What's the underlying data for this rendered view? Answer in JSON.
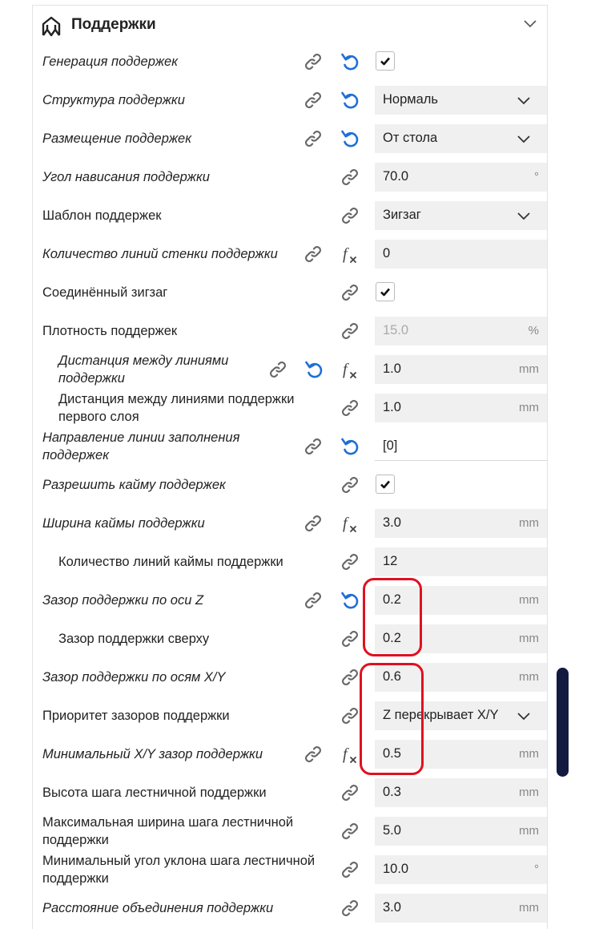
{
  "section": {
    "title": "Поддержки",
    "icon": "support-section-icon",
    "collapse_icon": "chevron-down-icon"
  },
  "accent_color": "#1f6fd6",
  "highlight_color": "#e01020",
  "rows": [
    {
      "label": "Генерация поддержек",
      "italic": true,
      "indent": false,
      "link": true,
      "reset": true,
      "fx": false,
      "control": "checkbox",
      "checked": true
    },
    {
      "label": "Структура поддержки",
      "italic": true,
      "indent": false,
      "link": true,
      "reset": true,
      "fx": false,
      "control": "select",
      "value": "Нормаль"
    },
    {
      "label": "Размещение поддержек",
      "italic": true,
      "indent": false,
      "link": true,
      "reset": true,
      "fx": false,
      "control": "select",
      "value": "От стола"
    },
    {
      "label": "Угол нависания поддержки",
      "italic": true,
      "indent": false,
      "link": true,
      "reset": false,
      "fx": false,
      "control": "number",
      "value": "70.0",
      "unit": "°"
    },
    {
      "label": "Шаблон поддержек",
      "italic": false,
      "indent": false,
      "link": true,
      "reset": false,
      "fx": false,
      "control": "select",
      "value": "Зигзаг"
    },
    {
      "label": "Количество линий стенки поддержки",
      "italic": true,
      "indent": false,
      "link": true,
      "reset": false,
      "fx": true,
      "control": "number",
      "value": "0",
      "unit": ""
    },
    {
      "label": "Соединённый зигзаг",
      "italic": false,
      "indent": false,
      "link": true,
      "reset": false,
      "fx": false,
      "control": "checkbox",
      "checked": true
    },
    {
      "label": "Плотность поддержек",
      "italic": false,
      "indent": false,
      "link": true,
      "reset": false,
      "fx": false,
      "control": "number",
      "value": "15.0",
      "unit": "%",
      "disabled": true
    },
    {
      "label": "Дистанция между линиями\nподдержки",
      "italic": true,
      "indent": true,
      "link": true,
      "reset": true,
      "fx": true,
      "control": "number",
      "value": "1.0",
      "unit": "mm"
    },
    {
      "label": "Дистанция между линиями поддержки\nпервого слоя",
      "italic": false,
      "indent": true,
      "link": true,
      "reset": false,
      "fx": false,
      "control": "number",
      "value": "1.0",
      "unit": "mm"
    },
    {
      "label": "Направление линии заполнения\nподдержек",
      "italic": true,
      "indent": false,
      "link": true,
      "reset": true,
      "fx": false,
      "control": "text",
      "value": "[0]"
    },
    {
      "label": "Разрешить кайму поддержек",
      "italic": true,
      "indent": false,
      "link": true,
      "reset": false,
      "fx": false,
      "control": "checkbox",
      "checked": true
    },
    {
      "label": "Ширина каймы поддержки",
      "italic": true,
      "indent": false,
      "link": true,
      "reset": false,
      "fx": true,
      "control": "number",
      "value": "3.0",
      "unit": "mm"
    },
    {
      "label": "Количество линий каймы поддержки",
      "italic": false,
      "indent": true,
      "link": true,
      "reset": false,
      "fx": false,
      "control": "number",
      "value": "12",
      "unit": ""
    },
    {
      "label": "Зазор поддержки по оси Z",
      "italic": true,
      "indent": false,
      "link": true,
      "reset": true,
      "fx": false,
      "control": "number",
      "value": "0.2",
      "unit": "mm"
    },
    {
      "label": "Зазор поддержки сверху",
      "italic": false,
      "indent": true,
      "link": true,
      "reset": false,
      "fx": false,
      "control": "number",
      "value": "0.2",
      "unit": "mm"
    },
    {
      "label": "Зазор поддержки по осям X/Y",
      "italic": true,
      "indent": false,
      "link": true,
      "reset": false,
      "fx": false,
      "control": "number",
      "value": "0.6",
      "unit": "mm"
    },
    {
      "label": "Приоритет зазоров поддержки",
      "italic": false,
      "indent": false,
      "link": true,
      "reset": false,
      "fx": false,
      "control": "select",
      "value": "Z перекрывает X/Y"
    },
    {
      "label": "Минимальный X/Y зазор поддержки",
      "italic": true,
      "indent": false,
      "link": true,
      "reset": false,
      "fx": true,
      "control": "number",
      "value": "0.5",
      "unit": "mm"
    },
    {
      "label": "Высота шага лестничной поддержки",
      "italic": false,
      "indent": false,
      "link": true,
      "reset": false,
      "fx": false,
      "control": "number",
      "value": "0.3",
      "unit": "mm"
    },
    {
      "label": "Максимальная ширина шага лестничной\nподдержки",
      "italic": false,
      "indent": false,
      "link": true,
      "reset": false,
      "fx": false,
      "control": "number",
      "value": "5.0",
      "unit": "mm"
    },
    {
      "label": "Минимальный угол уклона шага лестничной\nподдержки",
      "italic": false,
      "indent": false,
      "link": true,
      "reset": false,
      "fx": false,
      "control": "number",
      "value": "10.0",
      "unit": "°"
    },
    {
      "label": "Расстояние объединения поддержки",
      "italic": true,
      "indent": false,
      "link": true,
      "reset": false,
      "fx": false,
      "control": "number",
      "value": "3.0",
      "unit": "mm"
    }
  ]
}
